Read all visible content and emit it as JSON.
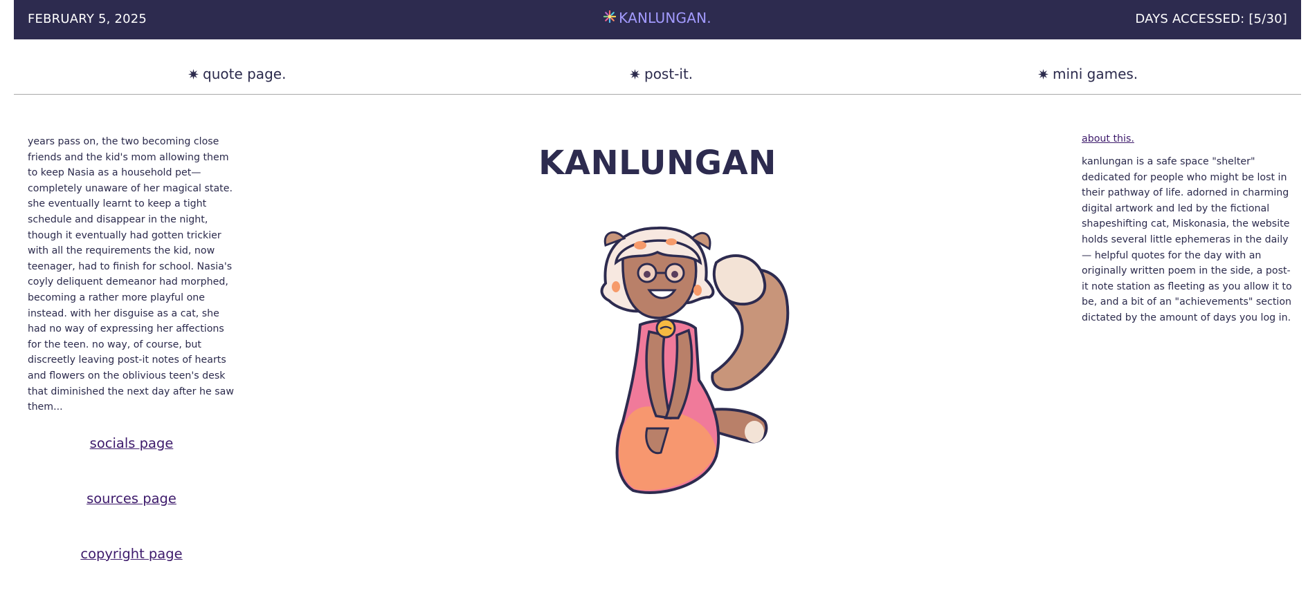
{
  "header": {
    "date": "FEBRUARY 5, 2025",
    "brand": "KANLUNGAN.",
    "days_accessed": "DAYS ACCESSED: [5/30]"
  },
  "nav": {
    "items": [
      {
        "label": "quote page."
      },
      {
        "label": "post-it."
      },
      {
        "label": "mini games."
      }
    ]
  },
  "story": {
    "text": "years pass on, the two becoming close friends and the kid's mom allowing them to keep Nasia as a household pet—completely unaware of her magical state. she eventually learnt to keep a tight schedule and disappear in the night, though it eventually had gotten trickier with all the requirements the kid, now teenager, had to finish for school. Nasia's coyly deliquent demeanor had morphed, becoming a rather more playful one instead. with her disguise as a cat, she had no way of expressing her affections for the teen. no way, of course, but discreetly leaving post-it notes of hearts and flowers on the oblivious teen's desk that diminished the next day after he saw them..."
  },
  "links": {
    "socials": "socials page",
    "sources": "sources page",
    "copyright": "copyright page"
  },
  "main": {
    "title": "KANLUNGAN"
  },
  "about": {
    "link": "about this.",
    "text": "kanlungan is a safe space \"shelter\" dedicated for people who might be lost in their pathway of life. adorned in charming digital artwork and led by the fictional shapeshifting cat, Miskonasia, the website holds several little ephemeras in the daily — helpful quotes for the day with an originally written poem in the side, a post-it note station as fleeting as you allow it to be, and a bit of an \"achievements\" section dictated by the amount of days you log in."
  },
  "colors": {
    "header_bg": "#2d2b4f",
    "brand_accent": "#a39bff",
    "link": "#3d1a6b",
    "text": "#2b2a4c"
  },
  "icons": {
    "brand": "sunburst-logo-icon",
    "nav": "star-burst-icon"
  }
}
